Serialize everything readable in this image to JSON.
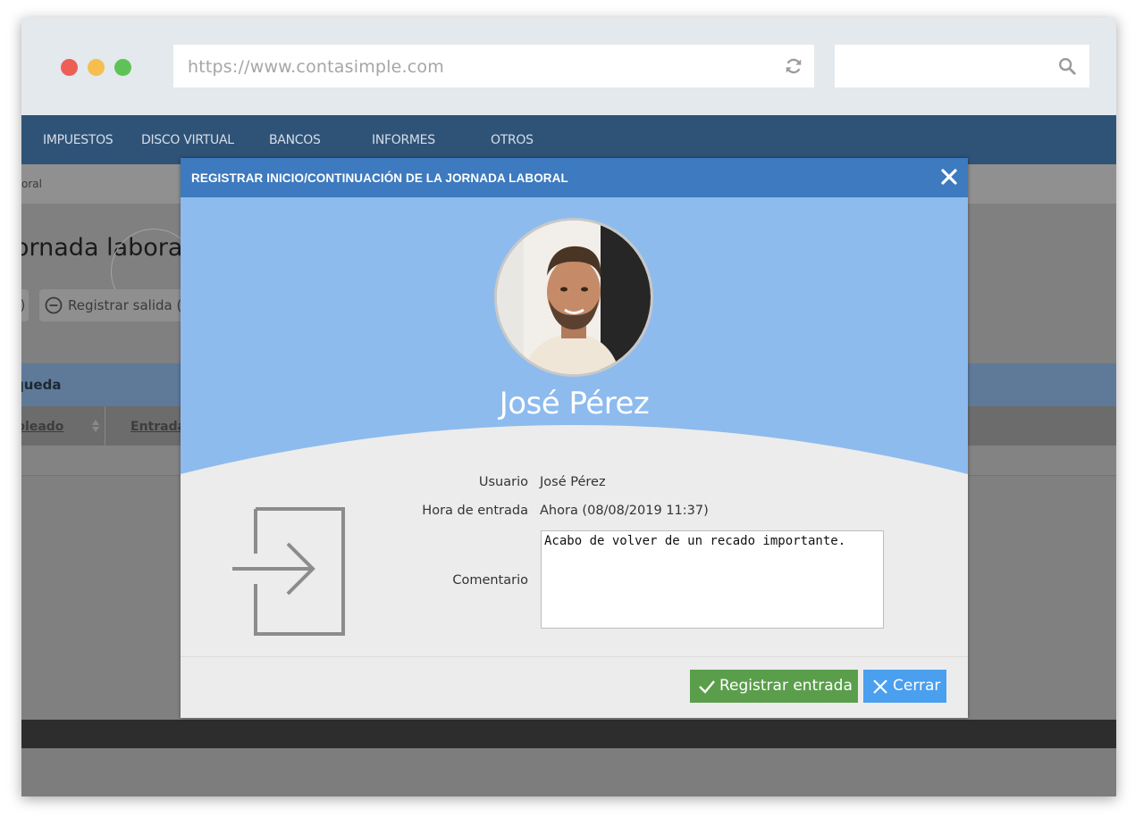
{
  "browser": {
    "url": "https://www.contasimple.com",
    "search_placeholder": "",
    "icons": [
      "reload-icon",
      "search-icon"
    ]
  },
  "nav": {
    "items": [
      "IMPUESTOS",
      "DISCO VIRTUAL",
      "BANCOS",
      "INFORMES",
      "OTROS"
    ]
  },
  "page": {
    "breadcrumb": "oral",
    "title": "ornada labora",
    "button_left": ")",
    "button_salida": "Registrar salida (F",
    "search_header": "queda",
    "columns": [
      "pleado",
      "Entrada"
    ]
  },
  "modal": {
    "title": "REGISTRAR INICIO/CONTINUACIÓN DE LA JORNADA LABORAL",
    "person_name": "José Pérez",
    "colors": {
      "header": "#3d7abf",
      "hero": "#8dbbee",
      "confirm": "#5a9e4b",
      "cancel": "#4a9fef"
    },
    "fields": {
      "usuario_label": "Usuario",
      "usuario_value": "José Pérez",
      "hora_label": "Hora de entrada",
      "hora_value": "Ahora (08/08/2019 11:37)",
      "comentario_label": "Comentario",
      "comentario_value": "Acabo de volver de un recado importante."
    },
    "buttons": {
      "register": "Registrar entrada",
      "close": "Cerrar"
    }
  }
}
